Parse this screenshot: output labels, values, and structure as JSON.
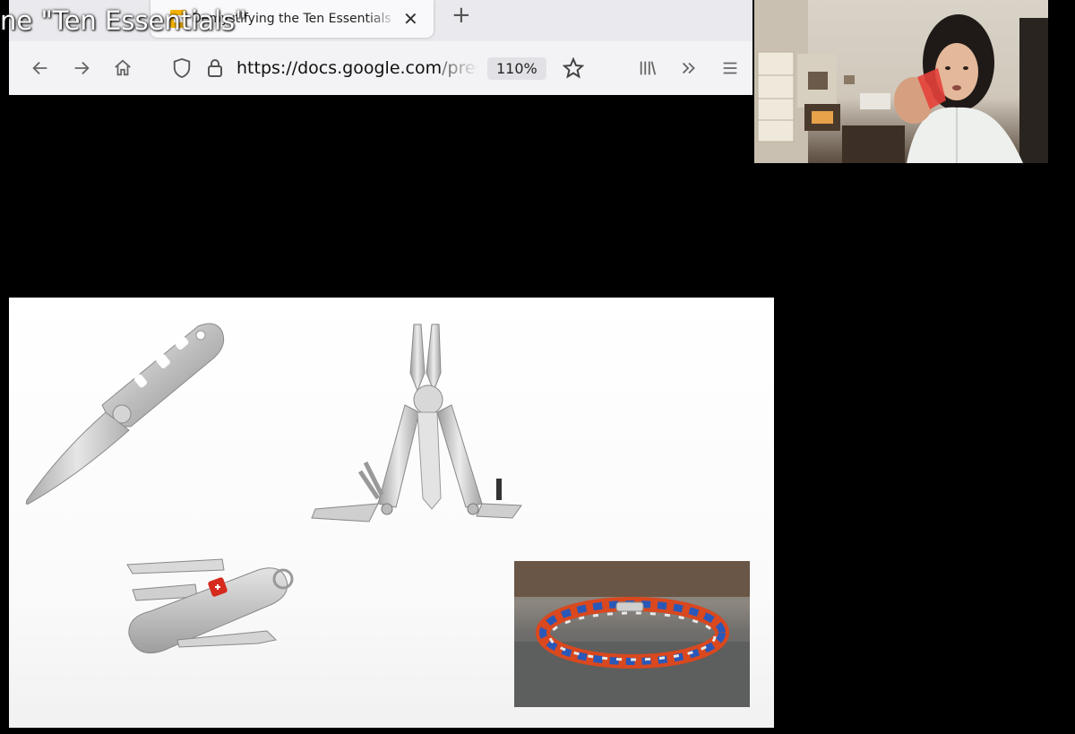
{
  "overlay": {
    "title": "ne \"Ten Essentials\""
  },
  "browser": {
    "tab": {
      "title": "Demystifying the Ten Essentials"
    },
    "url": {
      "host": "https://docs.google.com",
      "path": "/presentation"
    },
    "zoom": "110%"
  },
  "icons": {
    "back": "arrow-left-icon",
    "forward": "arrow-right-icon",
    "home": "home-icon",
    "shield": "shield-icon",
    "lock": "lock-icon",
    "bookmark": "star-icon",
    "library": "library-icon",
    "overflow": "chevron-double-right-icon",
    "menu": "hamburger-menu-icon"
  },
  "colors": {
    "slide_bg": "#ffffff",
    "stage_bg": "#000000",
    "paracord_orange": "#d9481e",
    "paracord_blue": "#2a58b8",
    "swiss_red": "#d62a1e"
  }
}
